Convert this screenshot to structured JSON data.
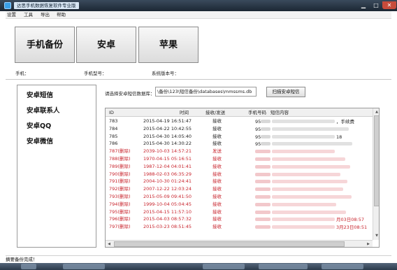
{
  "window": {
    "title": "达思手机数据恢复软件专业版"
  },
  "menu": [
    "设置",
    "工具",
    "导出",
    "帮助"
  ],
  "big_buttons": [
    "手机备份",
    "安卓",
    "苹果"
  ],
  "info": {
    "phone_label": "手机：",
    "model_label": "手机型号：",
    "version_label": "系统版本号："
  },
  "nav": [
    "安卓短信",
    "安卓联系人",
    "安卓QQ",
    "安卓微信"
  ],
  "db": {
    "label": "请选择安卓短信数据库：",
    "path": "\\备份\\123\\短信备份\\databases\\mmssms.db",
    "scan_button": "扫描安卓短信"
  },
  "grid": {
    "columns": [
      "ID",
      "时间",
      "接收/发送",
      "手机号码",
      "短信内容"
    ],
    "rows": [
      {
        "id": "783",
        "time": "2015-04-19  16:51:47",
        "dir": "接收",
        "phone": "95",
        "content": "，手续费",
        "deleted": false
      },
      {
        "id": "784",
        "time": "2015-04-22  10:42:55",
        "dir": "接收",
        "phone": "95",
        "content": "",
        "deleted": false
      },
      {
        "id": "785",
        "time": "2015-04-30  14:05:40",
        "dir": "接收",
        "phone": "95",
        "content": "18",
        "deleted": false
      },
      {
        "id": "786",
        "time": "2015-04-30  14:30:22",
        "dir": "接收",
        "phone": "95",
        "content": "",
        "deleted": false
      },
      {
        "id": "787(删除)",
        "time": "2039-10-03  14:57:21",
        "dir": "发送",
        "phone": "",
        "content": "",
        "deleted": true
      },
      {
        "id": "788(删除)",
        "time": "1970-04-15  05:16:51",
        "dir": "接收",
        "phone": "",
        "content": "",
        "deleted": true
      },
      {
        "id": "789(删除)",
        "time": "1987-12-04  04:01:41",
        "dir": "接收",
        "phone": "",
        "content": "",
        "deleted": true
      },
      {
        "id": "790(删除)",
        "time": "1988-02-03  06:35:29",
        "dir": "接收",
        "phone": "",
        "content": "",
        "deleted": true
      },
      {
        "id": "791(删除)",
        "time": "2004-10-30  01:24:41",
        "dir": "接收",
        "phone": "",
        "content": "",
        "deleted": true
      },
      {
        "id": "792(删除)",
        "time": "2007-12-22  12:03:24",
        "dir": "接收",
        "phone": "",
        "content": "",
        "deleted": true
      },
      {
        "id": "793(删除)",
        "time": "2015-05-09  09:41:50",
        "dir": "接收",
        "phone": "",
        "content": "",
        "deleted": true
      },
      {
        "id": "794(删除)",
        "time": "1999-10-04  05:04:45",
        "dir": "接收",
        "phone": "",
        "content": "",
        "deleted": true
      },
      {
        "id": "795(删除)",
        "time": "2015-04-15  11:57:10",
        "dir": "接收",
        "phone": "",
        "content": "",
        "deleted": true
      },
      {
        "id": "796(删除)",
        "time": "2015-04-03  08:57:32",
        "dir": "接收",
        "phone": "",
        "content": "月03日08:57",
        "deleted": true
      },
      {
        "id": "797(删除)",
        "time": "2015-03-23  08:51:45",
        "dir": "接收",
        "phone": "",
        "content": "3月23日08:51",
        "deleted": true
      }
    ]
  },
  "status": "摘要备份完成！",
  "colors": {
    "deleted_text": "#c8232c",
    "titlebar": "#1c2733"
  }
}
